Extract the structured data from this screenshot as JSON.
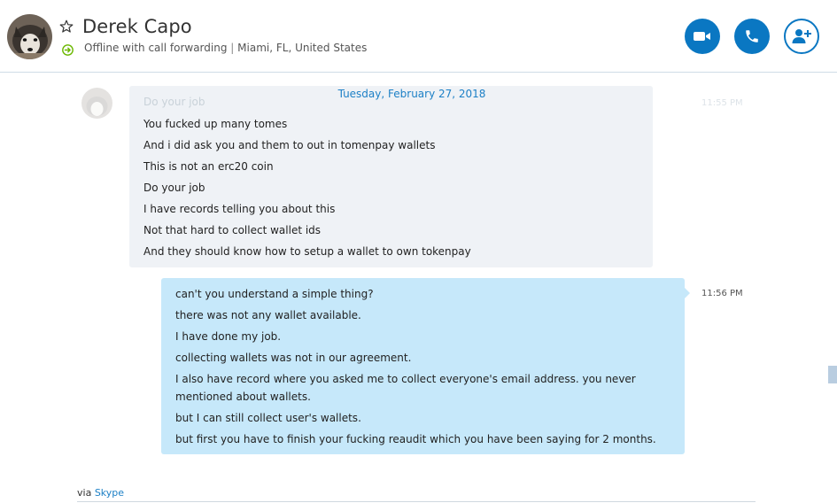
{
  "contact": {
    "name": "Derek Capo",
    "status": "Offline with call forwarding",
    "separator": "|",
    "location": "Miami, FL, United States"
  },
  "header_actions": {
    "video_icon": "video-camera-icon",
    "call_icon": "phone-icon",
    "add_icon": "add-person-icon"
  },
  "chat": {
    "date": "Tuesday, February 27, 2018",
    "faded_line": "Do your job",
    "faded_time": "11:55 PM",
    "incoming": [
      "You fucked up many tomes",
      "And i did ask you and them to out in tomenpay wallets",
      "This is not an erc20 coin",
      "Do your job",
      "I have records telling you about this",
      "Not that hard to collect wallet ids",
      "And they should know how to setup a wallet to own tokenpay"
    ],
    "outgoing": [
      "can't you understand a simple thing?",
      "there was not any wallet available.",
      "I have done my job.",
      "collecting wallets was not in our agreement.",
      "I also have record where you asked me to collect everyone's email address. you never",
      "mentioned about wallets.",
      "but I can still collect user's wallets.",
      "but first you have to finish your fucking reaudit which you have been saying for 2 months."
    ],
    "outgoing_time": "11:56 PM"
  },
  "footer": {
    "via": "via",
    "source": "Skype"
  },
  "colors": {
    "accent": "#0a77c2",
    "incoming_bubble": "#eff2f6",
    "outgoing_bubble": "#c6e8fa",
    "status_green": "#6bb700"
  }
}
